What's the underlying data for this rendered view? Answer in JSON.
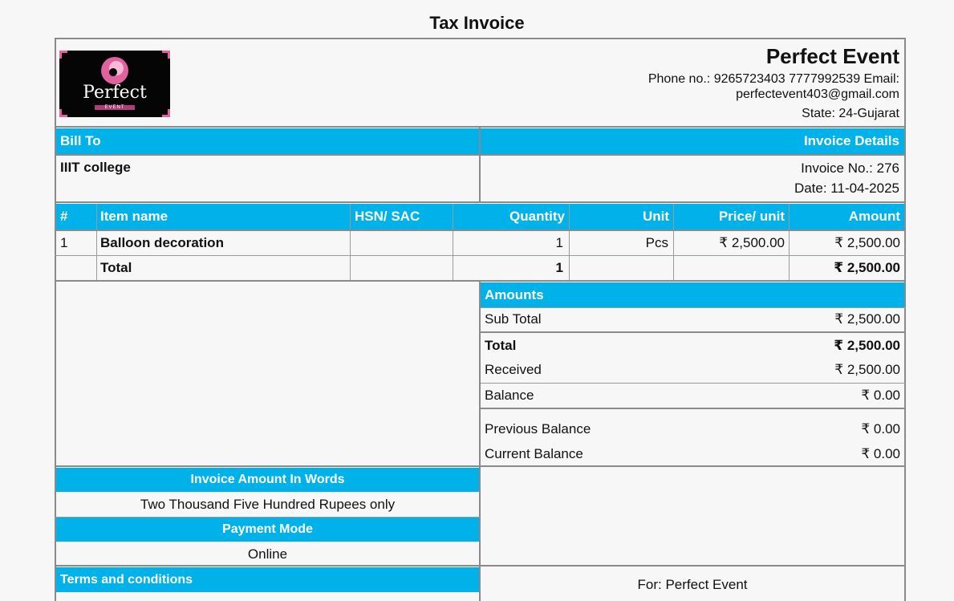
{
  "document": {
    "title": "Tax Invoice"
  },
  "company": {
    "logo_text": "Perfect",
    "logo_subtext": "EVENT",
    "name": "Perfect Event",
    "contact_line1": "Phone no.: 9265723403 7777992539 Email:",
    "contact_line2": "perfectevent403@gmail.com",
    "state": "State: 24-Gujarat"
  },
  "bill_to": {
    "header": "Bill To",
    "name": "IIIT college"
  },
  "invoice_details": {
    "header": "Invoice Details",
    "number": "Invoice No.: 276",
    "date": "Date: 11-04-2025"
  },
  "items_table": {
    "headers": [
      "#",
      "Item name",
      "HSN/ SAC",
      "Quantity",
      "Unit",
      "Price/ unit",
      "Amount"
    ],
    "rows": [
      [
        "1",
        "Balloon decoration",
        "",
        "1",
        "Pcs",
        "₹ 2,500.00",
        "₹ 2,500.00"
      ]
    ],
    "total": [
      "",
      "Total",
      "",
      "1",
      "",
      "",
      "₹ 2,500.00"
    ]
  },
  "amounts": {
    "header": "Amounts",
    "sub_total_label": "Sub Total",
    "sub_total": "₹ 2,500.00",
    "total_label": "Total",
    "total": "₹ 2,500.00",
    "received_label": "Received",
    "received": "₹ 2,500.00",
    "balance_label": "Balance",
    "balance": "₹ 0.00",
    "previous_balance_label": "Previous Balance",
    "previous_balance": "₹ 0.00",
    "current_balance_label": "Current Balance",
    "current_balance": "₹ 0.00"
  },
  "words": {
    "header": "Invoice Amount In Words",
    "value": "Two Thousand Five Hundred Rupees only"
  },
  "payment": {
    "header": "Payment Mode",
    "value": "Online"
  },
  "terms": {
    "header": "Terms and conditions"
  },
  "signature": {
    "for_label": "For: Perfect Event"
  },
  "colors": {
    "accent": "#00b1ea",
    "logo_pink": "#e0629e",
    "border": "#8a8a8a"
  }
}
